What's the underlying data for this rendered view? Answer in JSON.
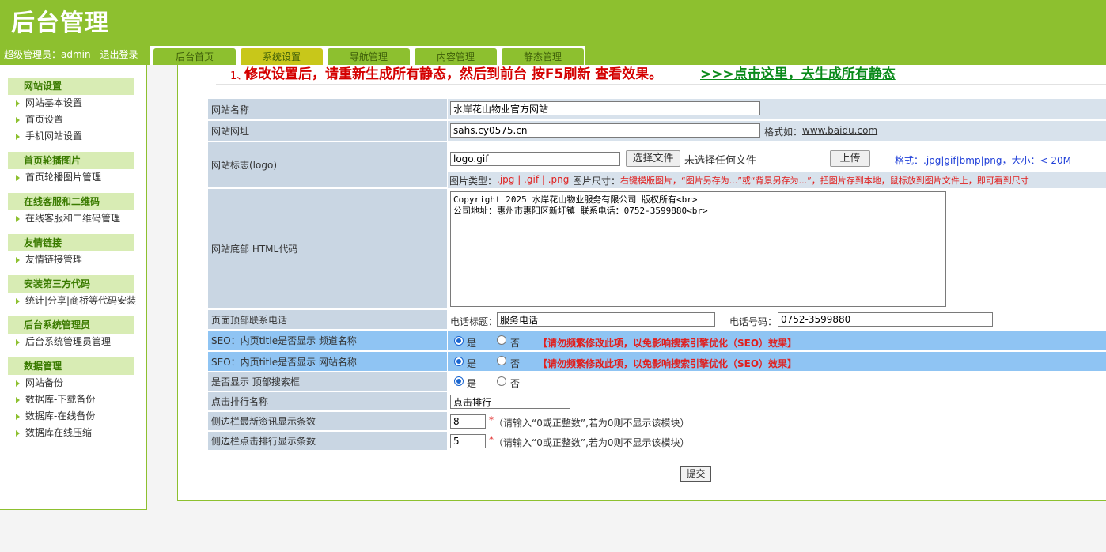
{
  "header": {
    "logo": "后台管理",
    "user_label": "超级管理员：admin",
    "logout": "退出登录"
  },
  "nav": {
    "tabs": [
      {
        "label": "后台首页"
      },
      {
        "label": "系统设置",
        "active": true
      },
      {
        "label": "导航管理"
      },
      {
        "label": "内容管理"
      },
      {
        "label": "静态管理"
      }
    ]
  },
  "sidebar": {
    "groups": [
      {
        "title": "网站设置",
        "items": [
          "网站基本设置",
          "首页设置",
          "手机网站设置"
        ]
      },
      {
        "title": "首页轮播图片",
        "items": [
          "首页轮播图片管理"
        ]
      },
      {
        "title": "在线客服和二维码",
        "items": [
          "在线客服和二维码管理"
        ]
      },
      {
        "title": "友情链接",
        "items": [
          "友情链接管理"
        ]
      },
      {
        "title": "安装第三方代码",
        "items": [
          "统计|分享|商桥等代码安装"
        ]
      },
      {
        "title": "后台系统管理员",
        "items": [
          "后台系统管理员管理"
        ]
      },
      {
        "title": "数据管理",
        "items": [
          "网站备份",
          "数据库-下载备份",
          "数据库-在线备份",
          "数据库在线压缩"
        ]
      }
    ]
  },
  "notice": {
    "num": "1、",
    "msg": "修改设置后，请重新生成所有静态，然后到前台 按F5刷新 查看效果。",
    "link": ">>>点击这里，去生成所有静态"
  },
  "form": {
    "site_name": {
      "label": "网站名称",
      "value": "水岸花山物业官方网站"
    },
    "site_url": {
      "label": "网站网址",
      "value": "sahs.cy0575.cn",
      "hint_prefix": "格式如：",
      "hint_link": "www.baidu.com"
    },
    "logo": {
      "label": "网站标志(logo)",
      "value": "logo.gif",
      "choose_btn": "选择文件",
      "no_file": "未选择任何文件",
      "upload_btn": "上传",
      "format_hint": "格式：.jpg|gif|bmp|png，大小：< 20M",
      "type_label": "图片类型：",
      "types": ".jpg | .gif | .png",
      "size_label": "图片尺寸：",
      "size_hint": "右键模版图片，“图片另存为...”或“背景另存为...”，把图片存到本地，鼠标放到图片文件上，即可看到尺寸"
    },
    "footer_html": {
      "label": "网站底部 HTML代码",
      "value": "Copyright 2025 水岸花山物业服务有限公司 版权所有<br>\n公司地址：惠州市惠阳区新圩镇 联系电话：0752-3599880<br>"
    },
    "top_phone": {
      "label": "页面顶部联系电话",
      "title_label": "电话标题：",
      "title_value": "服务电话",
      "number_label": "电话号码：",
      "number_value": "0752-3599880"
    },
    "seo_channel": {
      "label": "SEO：内页title是否显示 频道名称",
      "yes": "是",
      "no": "否",
      "selected": "yes",
      "warning": "【请勿频繁修改此项，以免影响搜索引擎优化（SEO）效果】"
    },
    "seo_site": {
      "label": "SEO：内页title是否显示 网站名称",
      "yes": "是",
      "no": "否",
      "selected": "yes",
      "warning": "【请勿频繁修改此项，以免影响搜索引擎优化（SEO）效果】"
    },
    "top_search": {
      "label": "是否显示 顶部搜索框",
      "yes": "是",
      "no": "否",
      "selected": "yes"
    },
    "click_rank_name": {
      "label": "点击排行名称",
      "value": "点击排行"
    },
    "latest_count": {
      "label": "侧边栏最新资讯显示条数",
      "value": "8",
      "star": "*",
      "hint": "（请输入“0或正整数”,若为0则不显示该模块）"
    },
    "click_count": {
      "label": "侧边栏点击排行显示条数",
      "value": "5",
      "star": "*",
      "hint": "（请输入“0或正整数”,若为0则不显示该模块）"
    },
    "submit": "提交"
  },
  "colors": {
    "brand_green": "#8dc02f",
    "active_tab": "#c8c71a",
    "label_bg": "#c9d6e3",
    "seo_bg": "#8fc4f3",
    "warning_red": "#e0201f"
  }
}
